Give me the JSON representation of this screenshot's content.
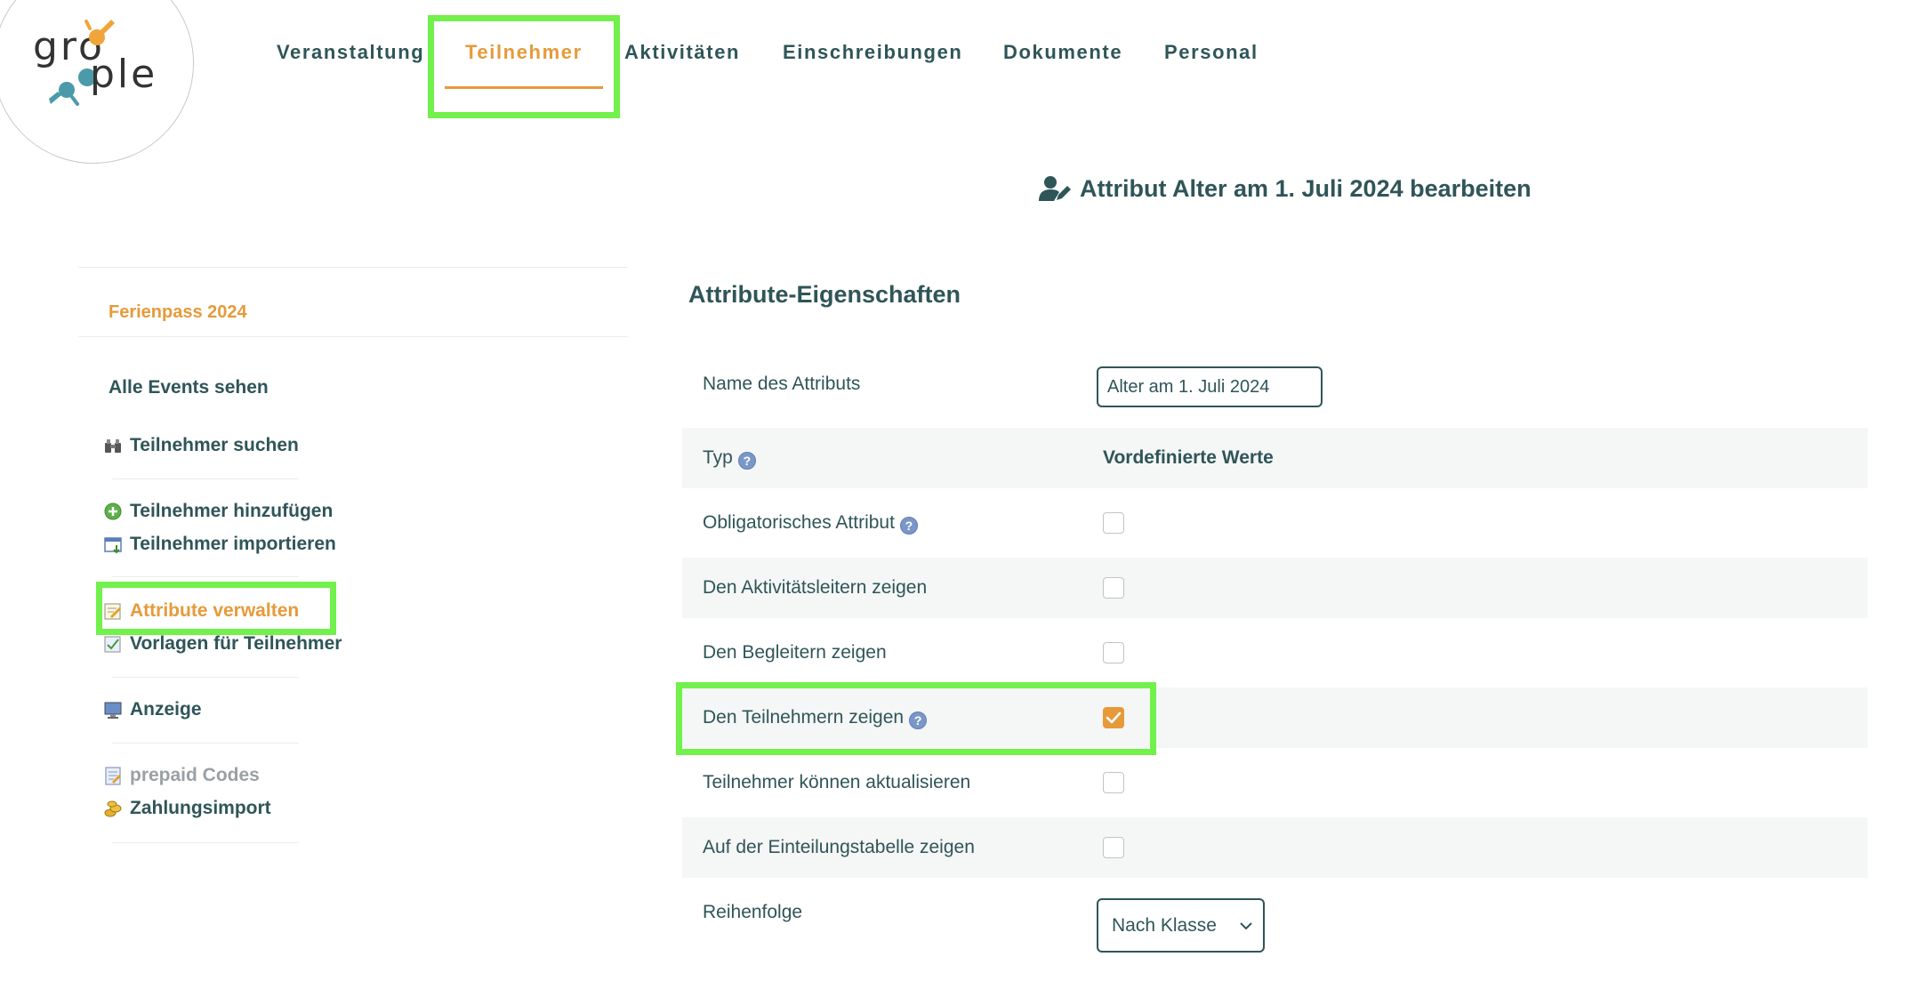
{
  "logo": {
    "part1": "gro",
    "part2": "ple"
  },
  "nav": {
    "tabs": [
      {
        "label": "Veranstaltung"
      },
      {
        "label": "Teilnehmer",
        "active": true
      },
      {
        "label": "Aktivitäten"
      },
      {
        "label": "Einschreibungen"
      },
      {
        "label": "Dokumente"
      },
      {
        "label": "Personal"
      }
    ]
  },
  "page": {
    "title": "Attribut Alter am 1. Juli 2024 bearbeiten",
    "title_icon": "user-edit-icon"
  },
  "sidebar": {
    "event": "Ferienpass 2024",
    "all_events": "Alle Events sehen",
    "items": [
      {
        "label": "Teilnehmer suchen",
        "icon": "binoculars-icon"
      },
      {
        "label": "Teilnehmer hinzufügen",
        "icon": "add-circle-icon"
      },
      {
        "label": "Teilnehmer importieren",
        "icon": "import-icon"
      },
      {
        "label": "Attribute verwalten",
        "icon": "edit-note-icon",
        "active": true
      },
      {
        "label": "Vorlagen für Teilnehmer",
        "icon": "template-icon"
      },
      {
        "label": "Anzeige",
        "icon": "monitor-icon"
      },
      {
        "label": "prepaid Codes",
        "icon": "notepad-icon",
        "disabled": true
      },
      {
        "label": "Zahlungsimport",
        "icon": "coins-icon"
      }
    ]
  },
  "section": {
    "title": "Attribute-Eigenschaften",
    "name_label": "Name des Attributs",
    "name_value": "Alter am 1. Juli 2024",
    "type_label": "Typ",
    "type_value": "Vordefinierte Werte",
    "checkboxes": [
      {
        "label": "Obligatorisches Attribut",
        "checked": false,
        "help": true
      },
      {
        "label": "Den Aktivitätsleitern zeigen",
        "checked": false,
        "help": false
      },
      {
        "label": "Den Begleitern zeigen",
        "checked": false,
        "help": false
      },
      {
        "label": "Den Teilnehmern zeigen",
        "checked": true,
        "help": true
      },
      {
        "label": "Teilnehmer können aktualisieren",
        "checked": false,
        "help": false
      },
      {
        "label": "Auf der Einteilungstabelle zeigen",
        "checked": false,
        "help": false
      }
    ],
    "order_label": "Reihenfolge",
    "order_value": "Nach Klasse"
  },
  "colors": {
    "accent": "#e69a3a",
    "text": "#2f5558",
    "highlight": "#72f04b",
    "row_shade": "#f5f6f6"
  }
}
